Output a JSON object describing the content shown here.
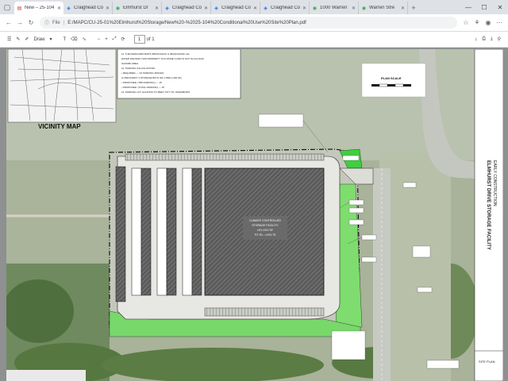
{
  "browser": {
    "tabs": [
      {
        "title": "New – 25-104",
        "icon": "pdf-icon",
        "active": true
      },
      {
        "title": "Craighead Co",
        "icon": "gis-icon"
      },
      {
        "title": "Elmhurst Dr",
        "icon": "maps-icon"
      },
      {
        "title": "Craighead Co",
        "icon": "gis-icon"
      },
      {
        "title": "Craighead Co",
        "icon": "gis-icon"
      },
      {
        "title": "Craighead Co",
        "icon": "gis-icon"
      },
      {
        "title": "1000 Warren",
        "icon": "maps-icon"
      },
      {
        "title": "Warren Stre",
        "icon": "maps-icon"
      }
    ],
    "address": {
      "label": "File",
      "url": "E:/MAPC/CU-25-01%20Elmhurst%20Storage/New%20-%2025-104%20Conditional%20Use%20Site%20Plan.pdf"
    }
  },
  "pdf_toolbar": {
    "draw_label": "Draw",
    "page_current": "1",
    "page_total": "of 1"
  },
  "drawing": {
    "vicinity_label": "VICINITY MAP",
    "plan_scale_label": "PLAN SCALE",
    "building_label_1": "CLIMATE CONTROLLED",
    "building_label_2": "STORAGE FACILITY",
    "building_label_3": "±XX,XXX SF",
    "building_label_4": "F.F. EL. =XXX.75",
    "title_block_1": "ELMHURST DRIVE STORAGE FACILITY",
    "title_block_2": "EARLY CONSTRUCTION",
    "sheet_label": "SITE PLAN",
    "notes": [
      "11. THE FEMA FIRM MAPS 05031C0211C & 05031C0233C ALL",
      "DATED 9/01/2010 THIS PROPERTY IS IN ZONE X AND IS NOT IN A FLOOD",
      "HAZARD AREA.",
      "12. PARKING CALCULATIONS:",
      "• REQUIRED — XX PARKING SPACES",
      "(1 PER EVERY 4 STORAGE BAYS OR 1 PER 1,000 SF)",
      "• PROPOSED: (TBD PARKING) — 15",
      "• PROPOSED: (TOTAL PARKING) — 15",
      "13. PARKING LOT LIGHTING TO MEET CITY OF JONESBORO."
    ]
  }
}
